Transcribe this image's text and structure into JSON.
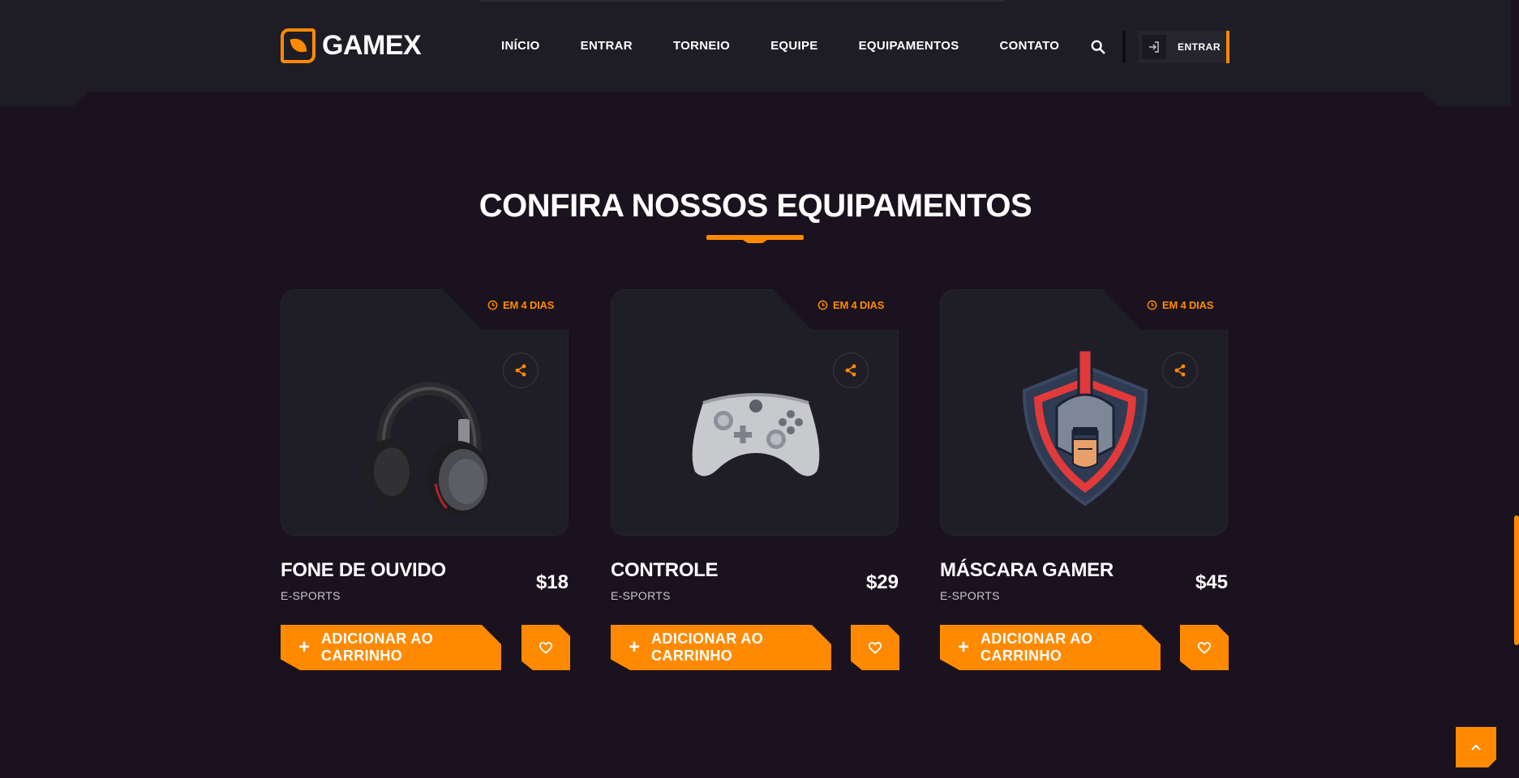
{
  "brand": {
    "name": "GAMEX",
    "accent_color": "#ff8a00"
  },
  "nav": {
    "items": [
      {
        "label": "INÍCIO"
      },
      {
        "label": "ENTRAR"
      },
      {
        "label": "TORNEIO"
      },
      {
        "label": "EQUIPE"
      },
      {
        "label": "EQUIPAMENTOS"
      },
      {
        "label": "CONTATO"
      }
    ],
    "login_label": "ENTRAR",
    "search_icon": "search-icon",
    "login_icon": "sign-in-icon"
  },
  "section": {
    "title": "CONFIRA NOSSOS EQUIPAMENTOS"
  },
  "products": [
    {
      "badge": "EM 4 DIAS",
      "name": "FONE DE OUVIDO",
      "category": "E-SPORTS",
      "price": "$18",
      "add_label": "ADICIONAR AO CARRINHO",
      "image": "headphones"
    },
    {
      "badge": "EM 4 DIAS",
      "name": "CONTROLE",
      "category": "E-SPORTS",
      "price": "$29",
      "add_label": "ADICIONAR AO CARRINHO",
      "image": "game-controller"
    },
    {
      "badge": "EM 4 DIAS",
      "name": "MÁSCARA GAMER",
      "category": "E-SPORTS",
      "price": "$45",
      "add_label": "ADICIONAR AO CARRINHO",
      "image": "spartan-mask"
    }
  ],
  "icons": {
    "share": "share-icon",
    "favorite": "heart-icon",
    "clock": "clock-icon",
    "back_to_top": "chevron-up-icon"
  }
}
